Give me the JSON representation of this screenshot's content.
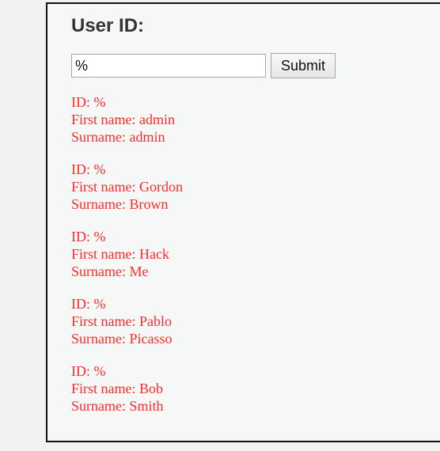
{
  "form": {
    "title": "User ID:",
    "input_value": "%",
    "submit_label": "Submit"
  },
  "records": [
    {
      "id": "ID: %",
      "first": "First name: admin",
      "surname": "Surname: admin"
    },
    {
      "id": "ID: %",
      "first": "First name: Gordon",
      "surname": "Surname: Brown"
    },
    {
      "id": "ID: %",
      "first": "First name: Hack",
      "surname": "Surname: Me"
    },
    {
      "id": "ID: %",
      "first": "First name: Pablo",
      "surname": "Surname: Picasso"
    },
    {
      "id": "ID: %",
      "first": "First name: Bob",
      "surname": "Surname: Smith"
    }
  ]
}
